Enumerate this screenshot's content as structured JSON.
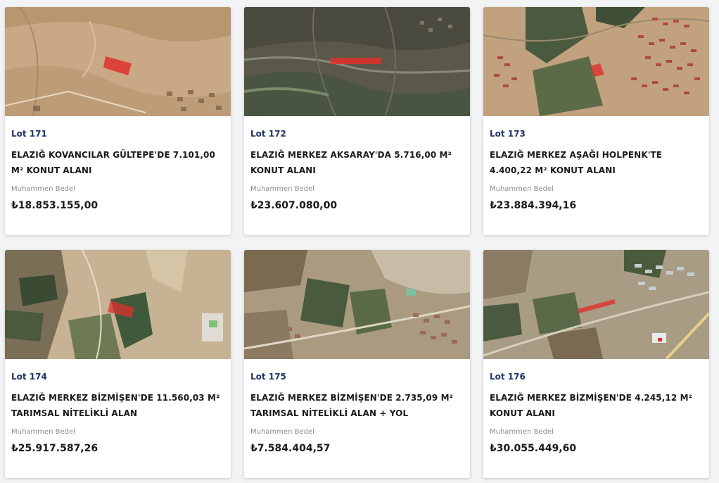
{
  "listing": {
    "price_label": "Muhammen Bedel",
    "lots": [
      {
        "lot": "Lot 171",
        "title": "ELAZIĞ KOVANCILAR GÜLTEPE'DE 7.101,00 M² KONUT ALANI",
        "price": "₺18.853.155,00"
      },
      {
        "lot": "Lot 172",
        "title": "ELAZIĞ MERKEZ AKSARAY'DA 5.716,00 M² KONUT ALANI",
        "price": "₺23.607.080,00"
      },
      {
        "lot": "Lot 173",
        "title": "ELAZIĞ MERKEZ AŞAĞI HOLPENK'TE 4.400,22 M² KONUT ALANI",
        "price": "₺23.884.394,16"
      },
      {
        "lot": "Lot 174",
        "title": "ELAZIĞ MERKEZ BİZMİŞEN'DE 11.560,03 M² TARIMSAL NİTELİKLİ ALAN",
        "price": "₺25.917.587,26"
      },
      {
        "lot": "Lot 175",
        "title": "ELAZIĞ MERKEZ BİZMİŞEN'DE 2.735,09 M² TARIMSAL NİTELİKLİ ALAN + YOL",
        "price": "₺7.584.404,57"
      },
      {
        "lot": "Lot 176",
        "title": "ELAZIĞ MERKEZ BİZMİŞEN'DE 4.245,12 M² KONUT ALANI",
        "price": "₺30.055.449,60"
      }
    ]
  },
  "colors": {
    "lot": "#1e3567",
    "parcel": "#e0302e",
    "background": "#f2f3f5"
  },
  "thumbnails": [
    {
      "icon": "satellite-map-arid-hillside",
      "base": "#c9a886",
      "accent": "#b38f6d"
    },
    {
      "icon": "satellite-map-dark-terrain",
      "base": "#5a5848",
      "accent": "#3e4a3a"
    },
    {
      "icon": "satellite-map-housing-blocks",
      "base": "#c2a27e",
      "accent": "#3f4f38"
    },
    {
      "icon": "satellite-map-fields-quarry",
      "base": "#c7b394",
      "accent": "#3b4a32"
    },
    {
      "icon": "satellite-map-town-fields",
      "base": "#a99a80",
      "accent": "#4a5a3c"
    },
    {
      "icon": "satellite-map-suburb-fields",
      "base": "#a89c84",
      "accent": "#4b5a3e"
    }
  ]
}
